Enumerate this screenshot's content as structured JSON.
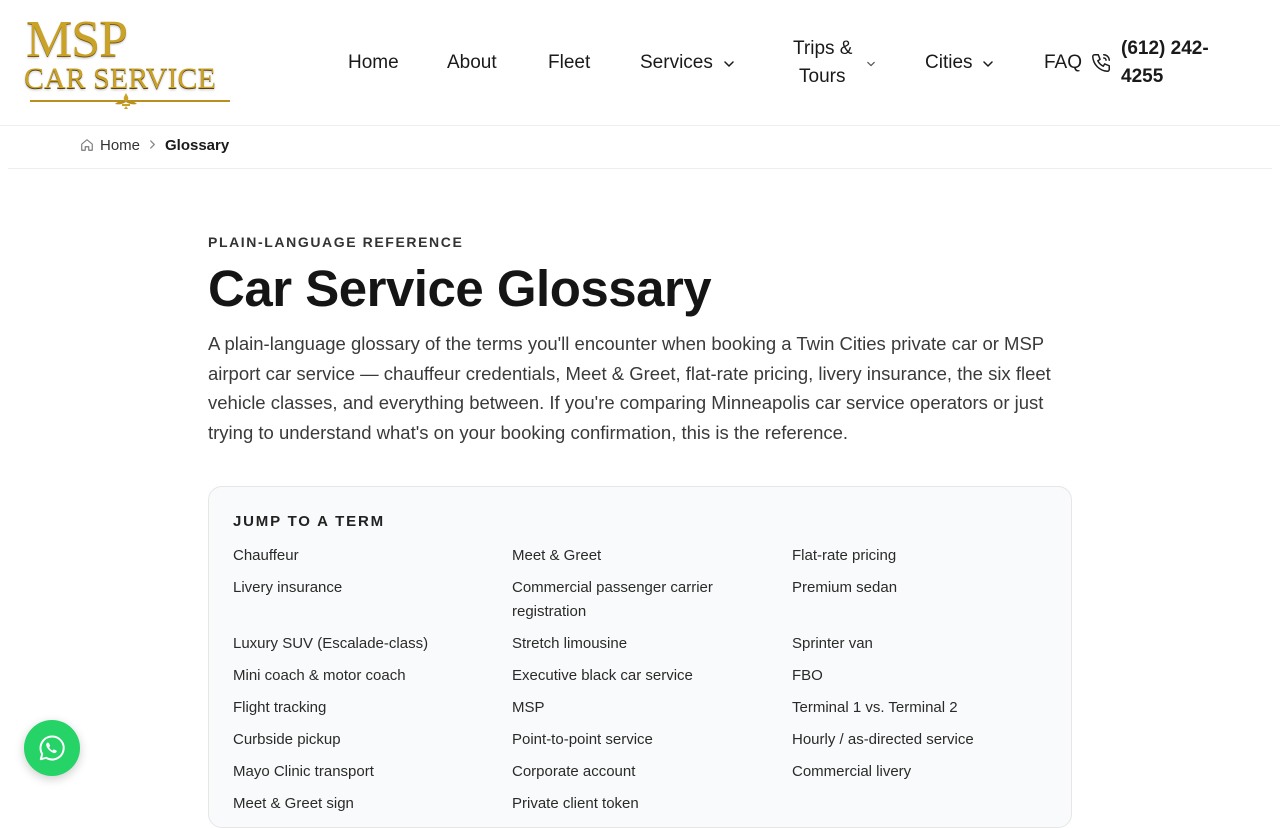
{
  "logo": {
    "line1": "MSP",
    "line2": "CAR SERVICE"
  },
  "nav": {
    "home": "Home",
    "about": "About",
    "fleet": "Fleet",
    "services": "Services",
    "trips_line1": "Trips &",
    "trips_line2": "Tours",
    "cities": "Cities",
    "faq": "FAQ",
    "phone_line1": "(612) 242-",
    "phone_line2": "4255"
  },
  "breadcrumb": {
    "home": "Home",
    "current": "Glossary"
  },
  "page": {
    "eyebrow": "PLAIN-LANGUAGE REFERENCE",
    "title": "Car Service Glossary",
    "intro": "A plain-language glossary of the terms you'll encounter when booking a Twin Cities private car or MSP airport car service — chauffeur credentials, Meet & Greet, flat-rate pricing, livery insurance, the six fleet vehicle classes, and everything between. If you're comparing Minneapolis car service operators or just trying to understand what's on your booking confirmation, this is the reference."
  },
  "jump": {
    "title": "JUMP TO A TERM",
    "terms": [
      "Chauffeur",
      "Meet & Greet",
      "Flat-rate pricing",
      "Livery insurance",
      "Commercial passenger carrier registration",
      "Premium sedan",
      "Luxury SUV (Escalade-class)",
      "Stretch limousine",
      "Sprinter van",
      "Mini coach & motor coach",
      "Executive black car service",
      "FBO",
      "Flight tracking",
      "MSP",
      "Terminal 1 vs. Terminal 2",
      "Curbside pickup",
      "Point-to-point service",
      "Hourly / as-directed service",
      "Mayo Clinic transport",
      "Corporate account",
      "Commercial livery",
      "Meet & Greet sign",
      "Private client token",
      ""
    ]
  },
  "colors": {
    "accent_gold": "#c9a227",
    "whatsapp": "#25d366"
  },
  "icons": [
    "home-icon",
    "chevron-right-icon",
    "chevron-down-icon",
    "phone-icon",
    "whatsapp-icon"
  ]
}
